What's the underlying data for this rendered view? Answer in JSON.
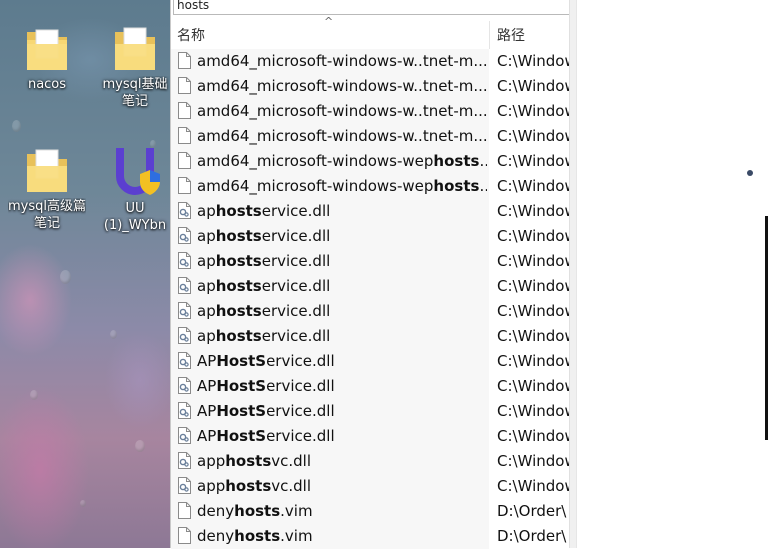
{
  "search": {
    "query": "hosts"
  },
  "columns": {
    "name": "名称",
    "path": "路径"
  },
  "desktop_icons": [
    {
      "label": "nacos",
      "icon": "folder-icon"
    },
    {
      "label": "mysql基础",
      "label2": "笔记",
      "icon": "folder-icon"
    },
    {
      "label": "mysql高级篇",
      "label2": "笔记",
      "icon": "folder-icon"
    },
    {
      "label": "UU",
      "label2": "(1)_WYbn",
      "icon": "installer-shield-icon"
    }
  ],
  "files": [
    {
      "pre": "amd64_microsoft-windows-w..tnet-m...",
      "hit": "",
      "post": "",
      "path": "C:\\Windows",
      "icon": "file-icon"
    },
    {
      "pre": "amd64_microsoft-windows-w..tnet-m...",
      "hit": "",
      "post": "",
      "path": "C:\\Windows",
      "icon": "file-icon"
    },
    {
      "pre": "amd64_microsoft-windows-w..tnet-m...",
      "hit": "",
      "post": "",
      "path": "C:\\Windows",
      "icon": "file-icon"
    },
    {
      "pre": "amd64_microsoft-windows-w..tnet-m...",
      "hit": "",
      "post": "",
      "path": "C:\\Windows",
      "icon": "file-icon"
    },
    {
      "pre": "amd64_microsoft-windows-wep",
      "hit": "hosts",
      "post": "...",
      "path": "C:\\Windows",
      "icon": "file-icon"
    },
    {
      "pre": "amd64_microsoft-windows-wep",
      "hit": "hosts",
      "post": "...",
      "path": "C:\\Windows",
      "icon": "file-icon"
    },
    {
      "pre": "ap",
      "hit": "hosts",
      "post": "ervice.dll",
      "path": "C:\\Windows",
      "icon": "dll-icon"
    },
    {
      "pre": "ap",
      "hit": "hosts",
      "post": "ervice.dll",
      "path": "C:\\Windows",
      "icon": "dll-icon"
    },
    {
      "pre": "ap",
      "hit": "hosts",
      "post": "ervice.dll",
      "path": "C:\\Windows",
      "icon": "dll-icon"
    },
    {
      "pre": "ap",
      "hit": "hosts",
      "post": "ervice.dll",
      "path": "C:\\Windows",
      "icon": "dll-icon"
    },
    {
      "pre": "ap",
      "hit": "hosts",
      "post": "ervice.dll",
      "path": "C:\\Windows",
      "icon": "dll-icon"
    },
    {
      "pre": "ap",
      "hit": "hosts",
      "post": "ervice.dll",
      "path": "C:\\Windows",
      "icon": "dll-icon"
    },
    {
      "pre": "AP",
      "hit": "HostS",
      "post": "ervice.dll",
      "path": "C:\\Windows",
      "icon": "dll-icon"
    },
    {
      "pre": "AP",
      "hit": "HostS",
      "post": "ervice.dll",
      "path": "C:\\Windows",
      "icon": "dll-icon"
    },
    {
      "pre": "AP",
      "hit": "HostS",
      "post": "ervice.dll",
      "path": "C:\\Windows",
      "icon": "dll-icon"
    },
    {
      "pre": "AP",
      "hit": "HostS",
      "post": "ervice.dll",
      "path": "C:\\Windows",
      "icon": "dll-icon"
    },
    {
      "pre": "app",
      "hit": "hosts",
      "post": "vc.dll",
      "path": "C:\\Windows",
      "icon": "dll-icon"
    },
    {
      "pre": "app",
      "hit": "hosts",
      "post": "vc.dll",
      "path": "C:\\Windows",
      "icon": "dll-icon"
    },
    {
      "pre": "deny",
      "hit": "hosts",
      "post": ".vim",
      "path": "D:\\Order\\",
      "icon": "file-icon"
    },
    {
      "pre": "deny",
      "hit": "hosts",
      "post": ".vim",
      "path": "D:\\Order\\",
      "icon": "file-icon"
    }
  ]
}
